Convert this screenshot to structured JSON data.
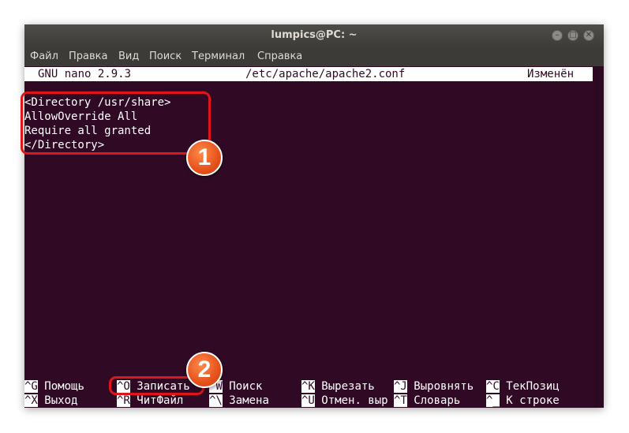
{
  "window": {
    "title": "lumpics@PC: ~",
    "buttons": [
      "–",
      "□",
      "✕"
    ]
  },
  "menu": [
    "Файл",
    "Правка",
    "Вид",
    "Поиск",
    "Терминал",
    "Справка"
  ],
  "nano": {
    "version": "GNU nano 2.9.3",
    "file": "/etc/apache/apache2.conf",
    "status": "Изменён"
  },
  "content_lines": [
    "<Directory /usr/share>",
    "AllowOverride All",
    "Require all granted",
    "</Directory>"
  ],
  "shortcuts": {
    "row1": [
      {
        "key": "^G",
        "label": "Помощь"
      },
      {
        "key": "^O",
        "label": "Записать"
      },
      {
        "key": "^W",
        "label": "Поиск"
      },
      {
        "key": "^K",
        "label": "Вырезать"
      },
      {
        "key": "^J",
        "label": "Выровнять"
      },
      {
        "key": "^C",
        "label": "ТекПозиц"
      }
    ],
    "row2": [
      {
        "key": "^X",
        "label": "Выход"
      },
      {
        "key": "^R",
        "label": "ЧитФайл"
      },
      {
        "key": "^\\",
        "label": "Замена"
      },
      {
        "key": "^U",
        "label": "Отмен. выр"
      },
      {
        "key": "^T",
        "label": "Словарь"
      },
      {
        "key": "^_",
        "label": "К строке"
      }
    ]
  },
  "annotations": {
    "badge1": "1",
    "badge2": "2",
    "highlight_color": "#e0151c",
    "badge_color": "#e6521b"
  },
  "colors": {
    "terminal_bg": "#300a24",
    "titlebar": "#3e3d39"
  }
}
